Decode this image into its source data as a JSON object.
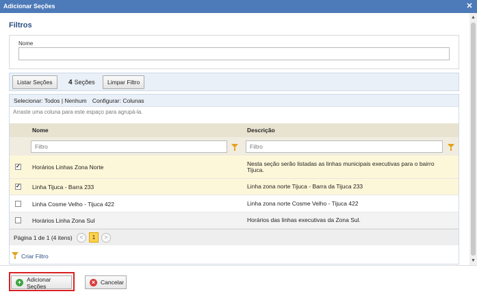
{
  "window": {
    "title": "Adicionar Seções",
    "close_symbol": "✕"
  },
  "filters": {
    "title": "Filtros",
    "name_label": "Nome",
    "name_value": ""
  },
  "toolbar": {
    "list_button": "Listar Seções",
    "count": "4",
    "count_label": "Seções",
    "clear_button": "Limpar Filtro"
  },
  "grid": {
    "select_prefix": "Selecionar:",
    "select_all": "Todos",
    "separator": "|",
    "select_none": "Nenhum",
    "configure_prefix": "Configurar:",
    "configure_columns": "Colunas",
    "group_hint": "Arraste uma coluna para este espaço para agrupá-la.",
    "columns": {
      "name": "Nome",
      "description": "Descrição"
    },
    "filter_placeholder_name": "Filtro",
    "filter_placeholder_desc": "Filtro",
    "rows": [
      {
        "name": "Horários Linhas Zona Norte",
        "description": "Nesta seção serão listadas as linhas municipais executivas para o bairro Tijuca.",
        "checked": true
      },
      {
        "name": "Linha Tijuca - Barra 233",
        "description": "Linha zona norte Tijuca - Barra da Tijuca 233",
        "checked": true
      },
      {
        "name": "Linha Cosme Velho - Tijuca 422",
        "description": "Linha zona norte Cosme Velho - Tijuca 422",
        "checked": false
      },
      {
        "name": "Horários Linha Zona Sul",
        "description": "Horários das linhas executivas da Zona Sul.",
        "checked": false
      }
    ],
    "pager": {
      "info": "Página 1 de 1 (4 itens)",
      "prev": "<",
      "current": "1",
      "next": ">"
    },
    "create_filter": "Criar Filtro"
  },
  "actions": {
    "add": "Adicionar Seções",
    "cancel": "Cancelar",
    "add_icon": "+",
    "cancel_icon": "×"
  },
  "colors": {
    "titlebar": "#4d7ab8",
    "accent": "#2a4f80",
    "highlight": "#d92020",
    "filter_icon": "#e4a11b"
  }
}
